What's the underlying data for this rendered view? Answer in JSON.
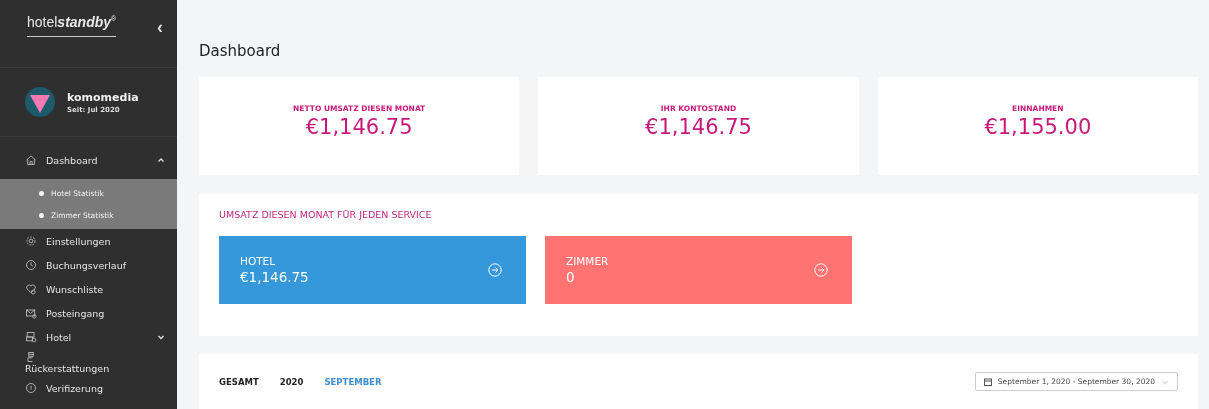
{
  "sidebar": {
    "logo": "hotel**standby**$^{®}$",
    "collapse": "‹",
    "profile": {
      "name": "komomedia",
      "since": "Seit: Jul 2020"
    },
    "items": [
      {
        "kind": "group",
        "label": "Dashboard",
        "expanded": true,
        "children": [
          {
            "label": "Hotel Statistik"
          },
          {
            "label": "Zimmer Statistik"
          }
        ]
      },
      {
        "kind": "link",
        "label": "Einstellungen"
      },
      {
        "kind": "link",
        "label": "Buchungsverlauf"
      },
      {
        "kind": "link",
        "label": "Wunschliste"
      },
      {
        "kind": "link",
        "label": "Posteingang"
      },
      {
        "kind": "group",
        "label": "Hotel",
        "expanded": false
      },
      {
        "kind": "stacked",
        "label": "Rückerstattungen"
      },
      {
        "kind": "link",
        "label": "Verifizerung"
      }
    ]
  },
  "page": {
    "title": "Dashboard"
  },
  "stats": [
    {
      "label": "NETTO UMSATZ DIESEN MONAT",
      "value": "€1,146.75"
    },
    {
      "label": "IHR KONTOSTAND",
      "value": "€1,146.75"
    },
    {
      "label": "EINNAHMEN",
      "value": "€1,155.00"
    }
  ],
  "services": {
    "title": "UMSATZ DIESEN MONAT FÜR JEDEN SERVICE",
    "tiles": [
      {
        "label": "HOTEL",
        "value": "€1,146.75",
        "color": "#3498db"
      },
      {
        "label": "ZIMMER",
        "value": "0",
        "color": "#ff7473"
      }
    ]
  },
  "filters": [
    {
      "label": "GESAMT",
      "selected": false
    },
    {
      "label": "2020",
      "selected": false
    },
    {
      "label": "SEPTEMBER",
      "selected": true
    }
  ],
  "date_range": "September 1, 2020 - September 30, 2020"
}
